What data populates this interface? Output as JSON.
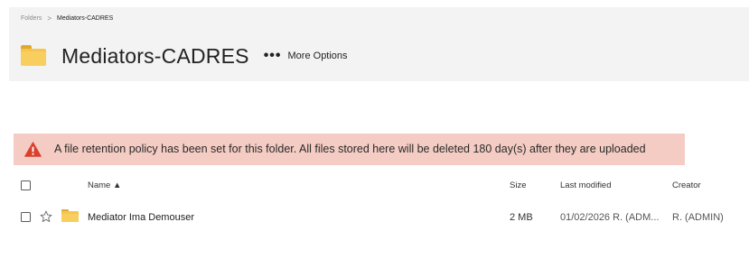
{
  "breadcrumb": {
    "root": "Folders",
    "separator": ">",
    "current": "Mediators-CADRES"
  },
  "header": {
    "title": "Mediators-CADRES",
    "more_dots": "•••",
    "more_options_label": "More Options"
  },
  "banner": {
    "message": "A file retention policy has been set for this folder. All files stored here will be deleted 180 day(s) after they are uploaded",
    "background": "#f4ccc3",
    "icon_color": "#d9412e"
  },
  "table": {
    "columns": {
      "name": "Name ▲",
      "size": "Size",
      "last_modified": "Last modified",
      "creator": "Creator"
    },
    "rows": [
      {
        "name": "Mediator Ima Demouser",
        "size": "2 MB",
        "last_modified": "01/02/2026 R. (ADM...",
        "creator": "R. (ADMIN)",
        "icon": "folder-icon"
      }
    ]
  }
}
